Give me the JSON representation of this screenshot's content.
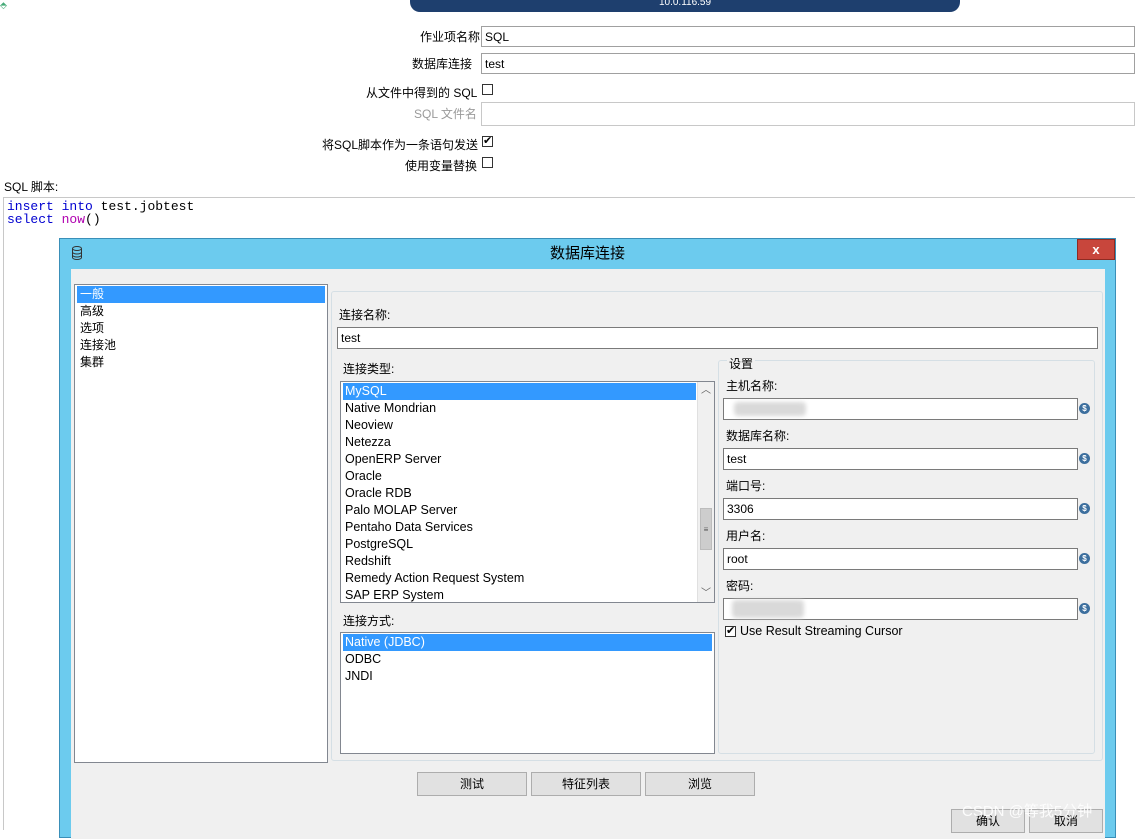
{
  "remote_bar": {
    "text": "10.0.116.59"
  },
  "job_form": {
    "name_label": "作业项名称",
    "name_value": "SQL",
    "connection_label": "数据库连接",
    "connection_value": "test",
    "sql_from_file_label": "从文件中得到的 SQL",
    "sql_from_file_checked": false,
    "sql_filename_label": "SQL 文件名",
    "sql_filename_value": "",
    "send_single_statement_label": "将SQL脚本作为一条语句发送",
    "send_single_statement_checked": true,
    "use_variable_substitution_label": "使用变量替换",
    "use_variable_substitution_checked": false,
    "sql_script_label": "SQL 脚本:"
  },
  "sql_script": {
    "line1": {
      "kw1": "insert",
      "kw2": "into",
      "rest": " test.jobtest"
    },
    "line2": {
      "kw1": "select",
      "fn": "now",
      "rest": "()"
    }
  },
  "dialog": {
    "title": "数据库连接",
    "close_label": "x",
    "nav_items": [
      "一般",
      "高级",
      "选项",
      "连接池",
      "集群"
    ],
    "nav_selected": 0,
    "connection_name_label": "连接名称:",
    "connection_name_value": "test",
    "connection_type_label": "连接类型:",
    "connection_types": [
      "MySQL",
      "Native Mondrian",
      "Neoview",
      "Netezza",
      "OpenERP Server",
      "Oracle",
      "Oracle RDB",
      "Palo MOLAP Server",
      "Pentaho Data Services",
      "PostgreSQL",
      "Redshift",
      "Remedy Action Request System",
      "SAP ERP System"
    ],
    "connection_type_selected": 0,
    "access_label": "连接方式:",
    "access_methods": [
      "Native (JDBC)",
      "ODBC",
      "JNDI"
    ],
    "access_selected": 0,
    "settings": {
      "group_label": "设置",
      "host_label": "主机名称:",
      "host_value": "",
      "db_name_label": "数据库名称:",
      "db_name_value": "test",
      "port_label": "端口号:",
      "port_value": "3306",
      "user_label": "用户名:",
      "user_value": "root",
      "password_label": "密码:",
      "password_value": "",
      "streaming_label": "Use Result Streaming Cursor",
      "streaming_checked": true
    },
    "buttons": {
      "test": "测试",
      "features": "特征列表",
      "explore": "浏览"
    },
    "footer_buttons": {
      "ok": "确认",
      "cancel": "取消"
    }
  },
  "watermark": "CSDN @等我5分钟",
  "icons": {
    "var_icon": "dollar-variable-icon",
    "db_icon": "database-icon",
    "checkmark": "check-icon"
  }
}
